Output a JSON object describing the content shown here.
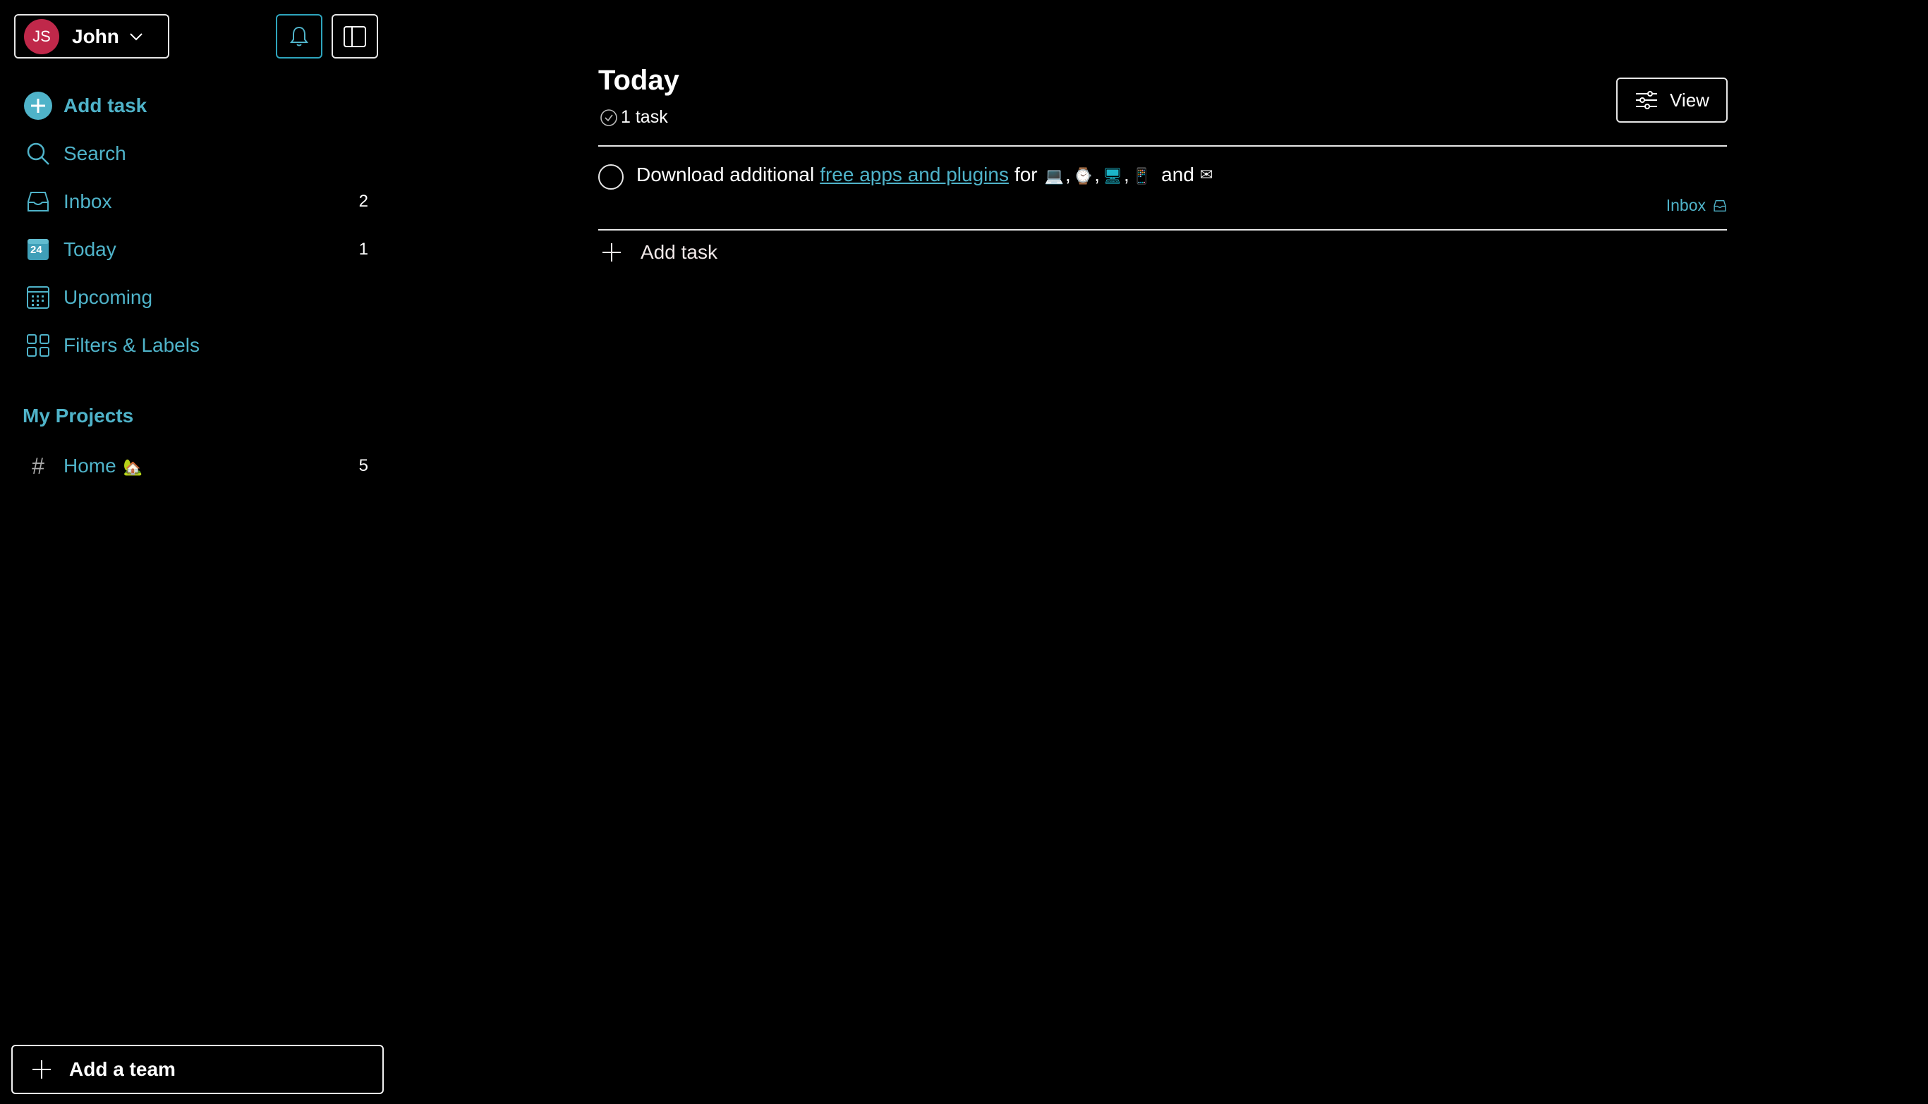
{
  "sidebar": {
    "user": {
      "initials": "JS",
      "name": "John"
    },
    "nav": {
      "add_task": "Add task",
      "search": "Search",
      "inbox": {
        "label": "Inbox",
        "count": "2"
      },
      "today": {
        "label": "Today",
        "count": "1",
        "date_badge": "24"
      },
      "upcoming": "Upcoming",
      "filters": "Filters & Labels"
    },
    "projects": {
      "heading": "My Projects",
      "items": [
        {
          "label": "Home",
          "emoji": "🏡",
          "count": "5"
        }
      ]
    },
    "add_team": "Add a team"
  },
  "main": {
    "title": "Today",
    "task_count": "1 task",
    "view_button": "View",
    "tasks": [
      {
        "text_before": "Download additional",
        "link": "free apps and plugins",
        "text_for": "for",
        "icons": [
          "💻",
          "⌚",
          "🖥",
          "📱"
        ],
        "text_and": "and",
        "icon_last": "✉",
        "project": "Inbox"
      }
    ],
    "add_task": "Add task"
  },
  "colors": {
    "accent": "#4fb3c9",
    "avatar": "#c0284a",
    "background": "#000000",
    "border": "#e7e7e7"
  }
}
